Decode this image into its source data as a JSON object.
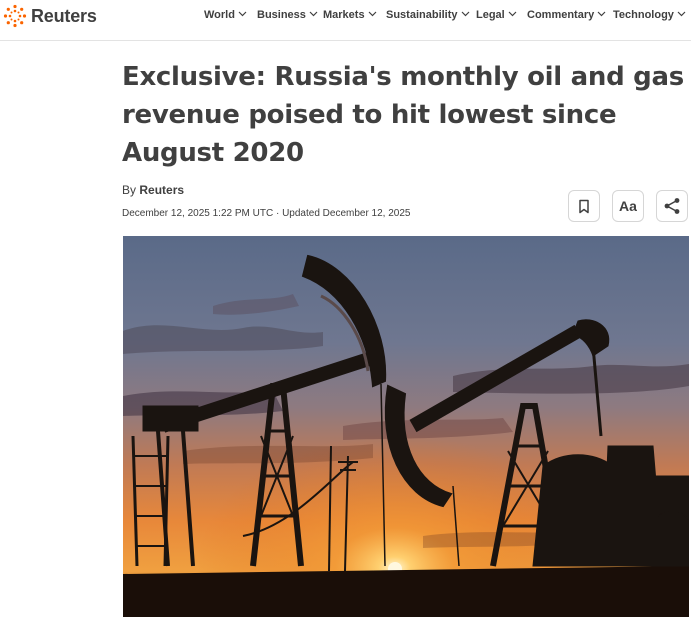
{
  "brand": {
    "name": "Reuters",
    "logo_icon": "reuters-dot-logo",
    "accent_color": "#fa6400"
  },
  "nav": {
    "items": [
      {
        "label": "World"
      },
      {
        "label": "Business"
      },
      {
        "label": "Markets"
      },
      {
        "label": "Sustainability"
      },
      {
        "label": "Legal"
      },
      {
        "label": "Commentary"
      },
      {
        "label": "Technology"
      }
    ]
  },
  "article": {
    "headline": "Exclusive: Russia's monthly oil and gas revenue poised to hit lowest since August 2020",
    "byline_prefix": "By",
    "author": "Reuters",
    "dateline": "December 12, 2025 1:22 PM UTC · Updated December 12, 2025"
  },
  "toolbar": {
    "bookmark_icon": "bookmark-icon",
    "text_size_label": "Aa",
    "share_icon": "share-icon"
  },
  "hero_image": {
    "subject": "oil-pumpjacks-at-sunset-photo"
  }
}
